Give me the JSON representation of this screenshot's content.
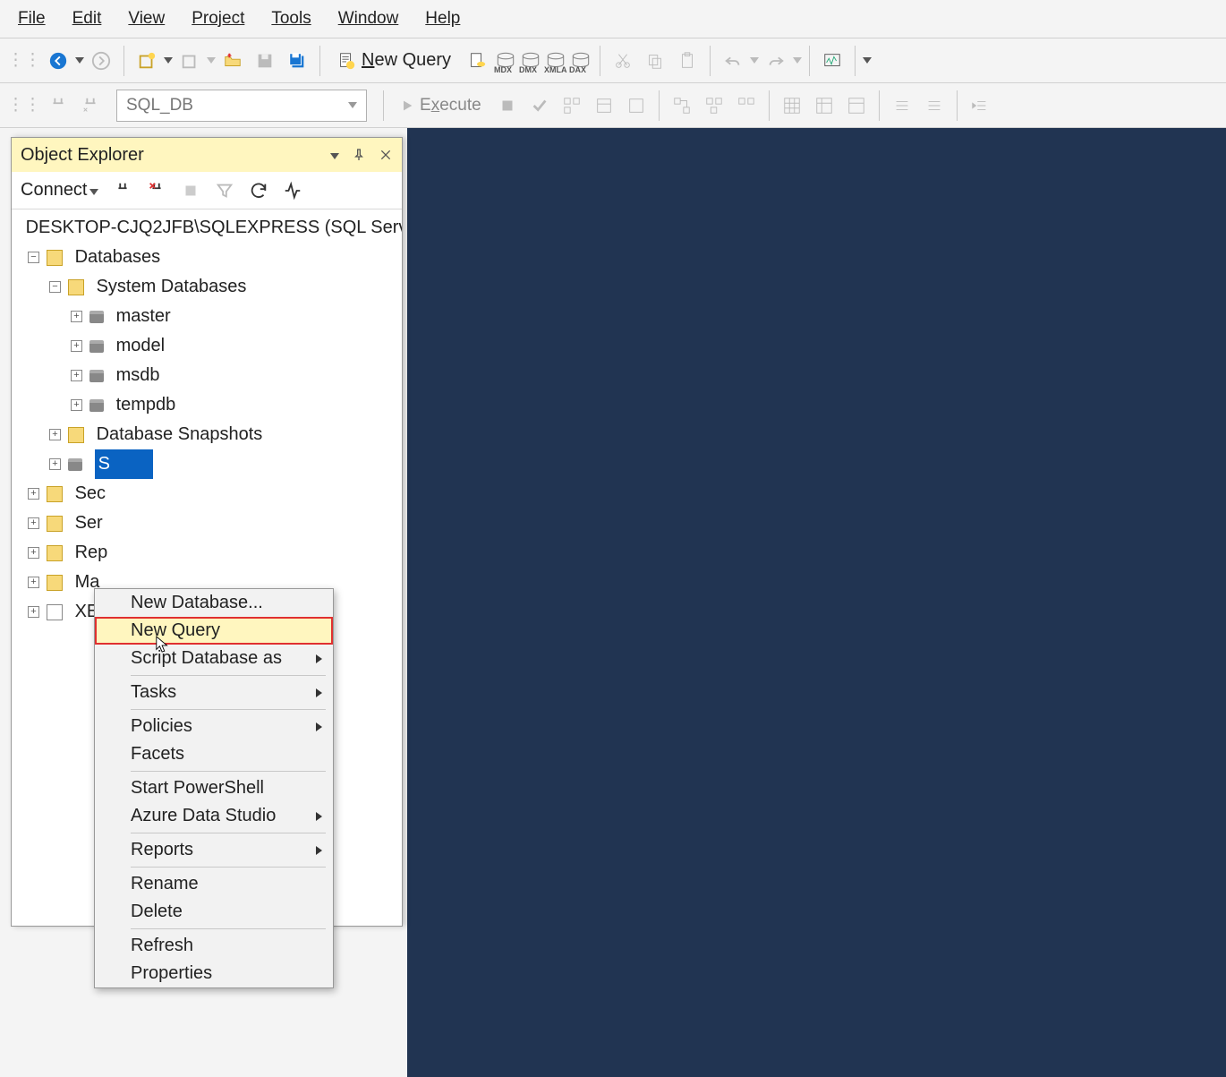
{
  "menubar": {
    "file": "File",
    "edit": "Edit",
    "view": "View",
    "project": "Project",
    "tools": "Tools",
    "window": "Window",
    "help": "Help"
  },
  "toolbar": {
    "new_query": "New Query",
    "mdx": "MDX",
    "dmx": "DMX",
    "xmla": "XMLA",
    "dax": "DAX"
  },
  "toolbar2": {
    "db": "SQL_DB",
    "execute": "Execute"
  },
  "object_explorer": {
    "title": "Object Explorer",
    "connect": "Connect",
    "server": "DESKTOP-CJQ2JFB\\SQLEXPRESS (SQL Serve",
    "databases": "Databases",
    "system_databases": "System Databases",
    "master": "master",
    "model": "model",
    "msdb": "msdb",
    "tempdb": "tempdb",
    "snapshots": "Database Snapshots",
    "selected_prefix": "S",
    "security": "Sec",
    "server_objects": "Ser",
    "replication": "Rep",
    "management": "Ma",
    "xevent": "XEv"
  },
  "context_menu": {
    "new_database": "New Database...",
    "new_query": "New Query",
    "script_db": "Script Database as",
    "tasks": "Tasks",
    "policies": "Policies",
    "facets": "Facets",
    "start_ps": "Start PowerShell",
    "ads": "Azure Data Studio",
    "reports": "Reports",
    "rename": "Rename",
    "delete": "Delete",
    "refresh": "Refresh",
    "properties": "Properties"
  }
}
